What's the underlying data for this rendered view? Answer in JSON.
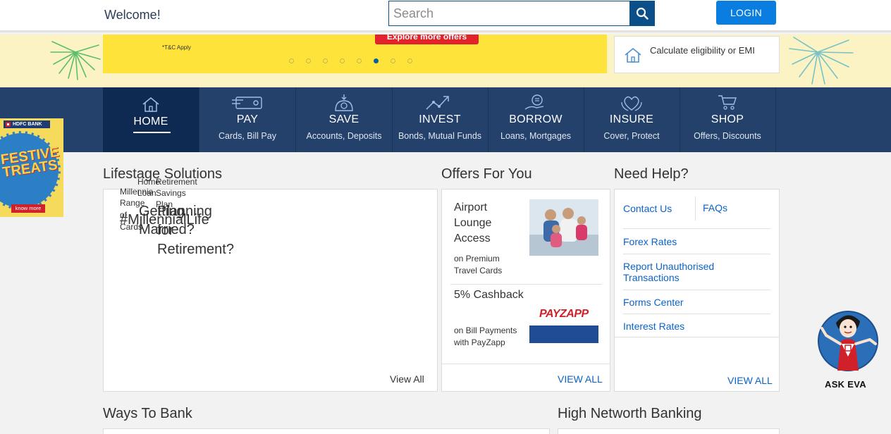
{
  "header": {
    "welcome": "Welcome!",
    "search_placeholder": "Search",
    "login_label": "LOGIN"
  },
  "banner": {
    "promo_button": "Explore more offers",
    "tnc": "*T&C Apply",
    "carousel_total": 8,
    "carousel_active_index": 5,
    "calc_text": "Calculate eligibility or EMI"
  },
  "nav": {
    "items": [
      {
        "title": "HOME",
        "sub": "",
        "icon": "home-icon"
      },
      {
        "title": "PAY",
        "sub": "Cards, Bill Pay",
        "icon": "card-icon"
      },
      {
        "title": "SAVE",
        "sub": "Accounts, Deposits",
        "icon": "savings-icon"
      },
      {
        "title": "INVEST",
        "sub": "Bonds, Mutual Funds",
        "icon": "growth-icon"
      },
      {
        "title": "BORROW",
        "sub": "Loans, Mortgages",
        "icon": "loan-icon"
      },
      {
        "title": "INSURE",
        "sub": "Cover, Protect",
        "icon": "shield-heart-icon"
      },
      {
        "title": "SHOP",
        "sub": "Offers, Discounts",
        "icon": "cart-icon"
      }
    ]
  },
  "festive": {
    "bank_label": "HDFC BANK",
    "headline": "FESTIVE TREATS",
    "cta": "know more"
  },
  "lifestage": {
    "title": "Lifestage Solutions",
    "view_all": "View All",
    "fragments": {
      "millennia": "Millennia",
      "range": "Range",
      "of": "of",
      "cards": "Cards",
      "millennial_life": "#MillennialLife",
      "home": "Home",
      "loan": "Loan",
      "getting": "Getting",
      "married": "Married?",
      "retirement_small": "Retirement",
      "savings": "Savings",
      "plan": "Plan",
      "planning": "Planning",
      "for": "for",
      "retirement": "Retirement?"
    }
  },
  "offers": {
    "title": "Offers For You",
    "items": [
      {
        "title": "Airport Lounge Access",
        "sub": "on Premium Travel Cards"
      },
      {
        "title": "5% Cashback",
        "sub": "on Bill Payments with PayZapp"
      }
    ],
    "payzapp_logo": "PAYZAPP",
    "view_all": "VIEW ALL"
  },
  "help": {
    "title": "Need Help?",
    "contact": "Contact Us",
    "faqs": "FAQs",
    "links": [
      "Forex Rates",
      "Report Unauthorised Transactions",
      "Forms Center",
      "Interest Rates"
    ],
    "view_all": "VIEW ALL"
  },
  "bottom": {
    "ways_to_bank": "Ways To Bank",
    "high_networth": "High Networth Banking"
  },
  "eva": {
    "label": "ASK EVA"
  },
  "colors": {
    "nav_bg": "#24416b",
    "nav_active": "#0e2a53",
    "login_blue": "#0a7ee0",
    "link_blue": "#0a63c8",
    "promo_yellow": "#fde33a",
    "offer_red": "#e3232b"
  }
}
